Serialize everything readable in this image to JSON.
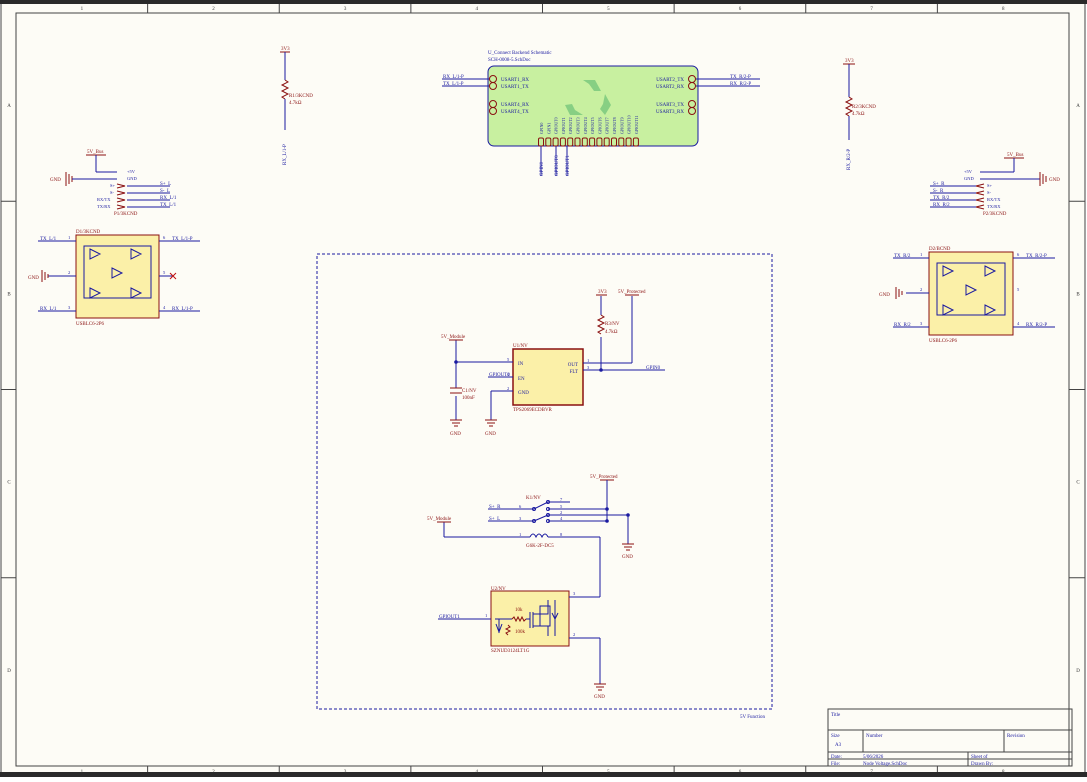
{
  "frame": {
    "columns": [
      "1",
      "2",
      "3",
      "4",
      "5",
      "6",
      "7",
      "8"
    ],
    "rows": [
      "A",
      "B",
      "C",
      "D"
    ]
  },
  "module": {
    "designator": "U_Connect Backend Schematic",
    "file": "SCH-0008-5.SchDoc",
    "left_pins": [
      "USART1_RX",
      "USART1_TX",
      "USART4_RX",
      "USART4_TX"
    ],
    "left_nets": [
      "RX_L/1-P",
      "TX_L/1-P"
    ],
    "right_pins": [
      "USART2_TX",
      "USART2_RX",
      "USART3_TX",
      "USART3_RX"
    ],
    "right_nets": [
      "TX_R/2-P",
      "RX_R/2-P"
    ],
    "gpio_labels": [
      "GPIN0",
      "GPIN1",
      "GPIOUT0",
      "GPIOUT1",
      "GPIOUT2",
      "GPIOUT3",
      "GPIOUT4",
      "GPIOUT5",
      "GPIOUT6",
      "GPIOUT7",
      "GPIOUT8",
      "GPIOUT9",
      "GPIOUT10",
      "GPIOUT11"
    ],
    "bottom_nets": [
      "GPIN0",
      "GPIOUT0",
      "GPIOUT1"
    ]
  },
  "r1": {
    "ref": "R1/3KCND",
    "value": "4.7kΩ",
    "power": "3V3",
    "net": "RX_L/1-P"
  },
  "r2": {
    "ref": "R2/3KCND",
    "value": "4.7kΩ",
    "power": "3V3",
    "net": "RX_R/2-P"
  },
  "p1": {
    "power": "5V_Bus",
    "gnd": "GND",
    "ref": "P1/3KCND",
    "pins": [
      "+5V",
      "GND",
      "S+",
      "S-",
      "RX/TX",
      "TX/RX"
    ],
    "nets": [
      "S+_L",
      "S-_L",
      "RX_L/1",
      "TX_L/1"
    ]
  },
  "p2": {
    "power": "5V_Bus",
    "gnd": "GND",
    "ref": "P2/3KCND",
    "pins": [
      "+5V",
      "GND",
      "S+",
      "S-",
      "RX/TX",
      "TX/RX"
    ],
    "nets": [
      "S+_R",
      "S-_R",
      "TX_R/2",
      "RX_R/2"
    ]
  },
  "d1": {
    "ref": "D1/3KCND",
    "part": "USBLC6-2P6",
    "gnd": "GND",
    "nets": [
      "TX_L/1",
      "TX_L/1-P",
      "RX_L/1",
      "RX_L/1-P"
    ],
    "pins": [
      "1",
      "6",
      "2",
      "5",
      "3",
      "4"
    ]
  },
  "d2": {
    "ref": "D2/BCND",
    "part": "USBLC6-2P6",
    "gnd": "GND",
    "nets": [
      "TX_R/2",
      "TX_R/2-P",
      "RX_R/2",
      "RX_R/2-P"
    ],
    "pins": [
      "1",
      "6",
      "2",
      "5",
      "3",
      "4"
    ]
  },
  "block": {
    "label": "5V Function",
    "u1": {
      "ref": "U1/NV",
      "part": "TPS2069ECDBVR",
      "pins": [
        "IN",
        "EN",
        "GND",
        "OUT",
        "FLT"
      ],
      "pin_numbers": [
        "5",
        "4",
        "2",
        "1",
        "3"
      ],
      "in_net": "5V_Module",
      "en_net": "GPIOUT0",
      "flt_net": "GPIN0"
    },
    "r3": {
      "ref": "R3/NV",
      "value": "4.7kΩ",
      "power": "3V3"
    },
    "out_net": "5V_Protected",
    "c1": {
      "ref": "C1/NV",
      "value": "100nF"
    },
    "gnds": [
      "GND",
      "GND"
    ],
    "k1": {
      "ref": "K1/NV",
      "part": "G6K-2F-DC5",
      "nets": [
        "S+_R",
        "S+_L",
        "5V_Module"
      ],
      "power": "5V_Protected",
      "gnd": "GND",
      "pins": [
        "6",
        "3",
        "1",
        "7",
        "5",
        "2",
        "4",
        "8"
      ]
    },
    "u2": {
      "ref": "U2/NV",
      "part": "SZNUD3124LT1G",
      "net": "GPIOUT1",
      "r_a": "10k",
      "r_b": "100k",
      "gnd": "GND",
      "pins": [
        "1",
        "3",
        "2"
      ]
    }
  },
  "title_block": {
    "title_label": "Title",
    "size_label": "Size",
    "size": "A3",
    "number_label": "Number",
    "revision_label": "Revision",
    "date_label": "Date:",
    "date": "5/06/2026",
    "file_label": "File:",
    "file": "Node Voltage.SchDoc",
    "sheet": "Sheet of",
    "drawn": "Drawn By:"
  },
  "colors": {
    "wire": "#1a1aa0",
    "component": "#8a1010",
    "body_fill": "#fbf0a8",
    "module_fill": "#c8f0a0",
    "paper": "#fdfcf6"
  }
}
